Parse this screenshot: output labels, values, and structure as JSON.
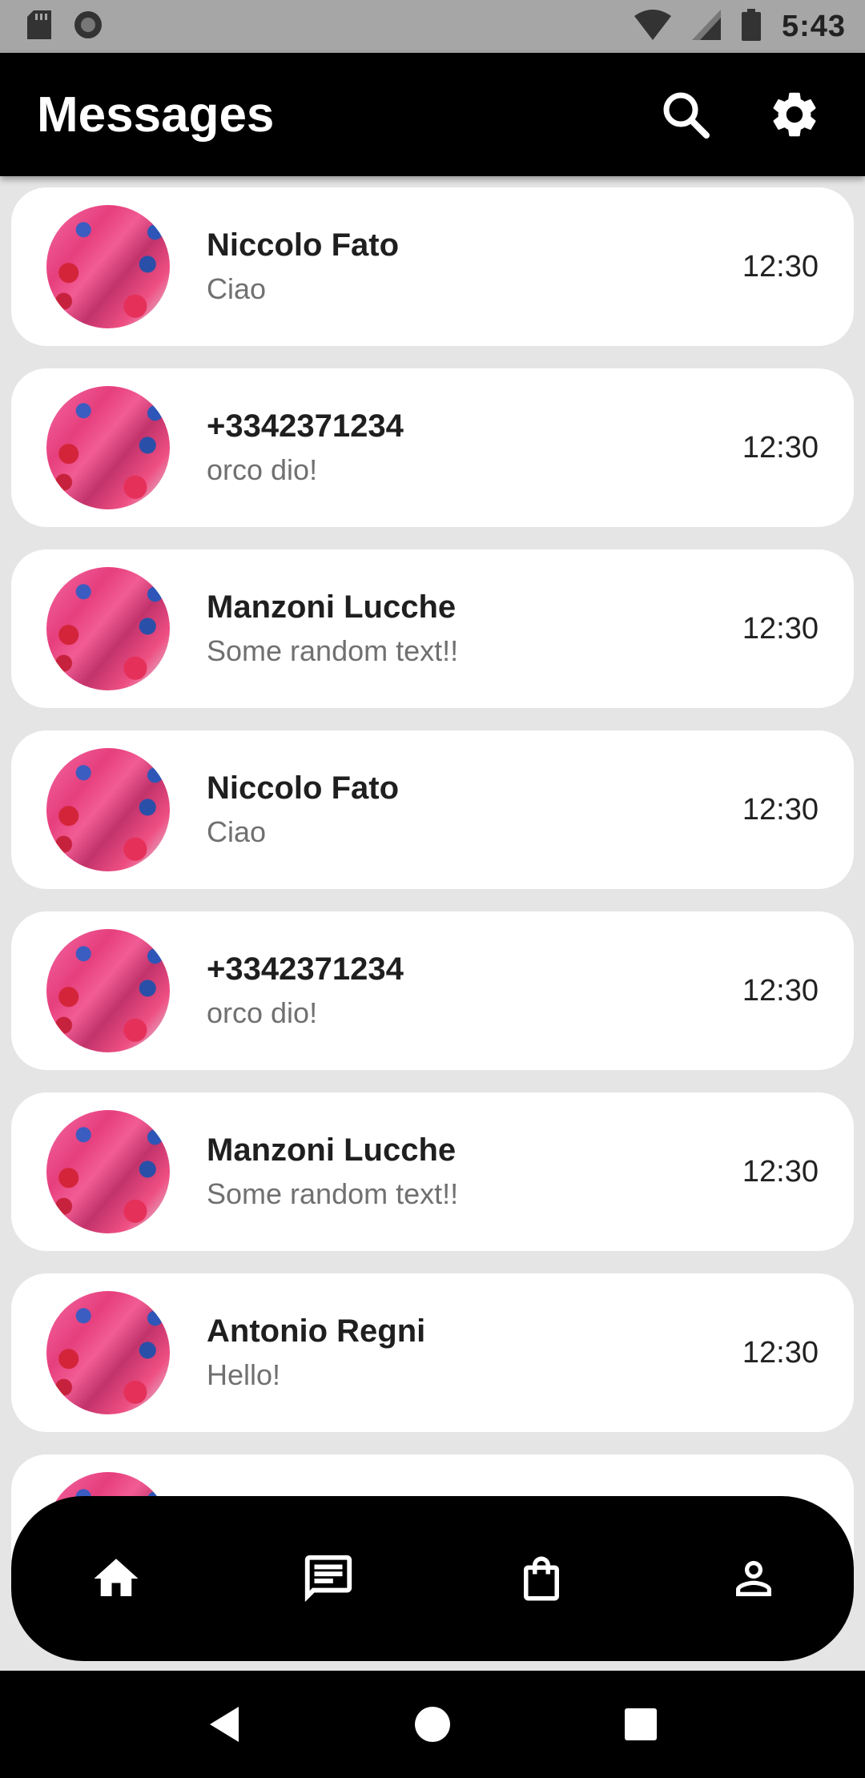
{
  "status_bar": {
    "time": "5:43",
    "icons": [
      "sd-card-icon",
      "record-icon",
      "wifi-icon",
      "cell-signal-icon",
      "battery-icon"
    ]
  },
  "app_bar": {
    "title": "Messages",
    "actions": [
      "search-icon",
      "settings-gear-icon"
    ]
  },
  "conversations": [
    {
      "name": "Niccolo Fato",
      "preview": "Ciao",
      "time": "12:30"
    },
    {
      "name": "+3342371234",
      "preview": "orco dio!",
      "time": "12:30"
    },
    {
      "name": "Manzoni Lucche",
      "preview": "Some random text!!",
      "time": "12:30"
    },
    {
      "name": "Niccolo Fato",
      "preview": "Ciao",
      "time": "12:30"
    },
    {
      "name": "+3342371234",
      "preview": "orco dio!",
      "time": "12:30"
    },
    {
      "name": "Manzoni Lucche",
      "preview": "Some random text!!",
      "time": "12:30"
    },
    {
      "name": "Antonio Regni",
      "preview": "Hello!",
      "time": "12:30"
    }
  ],
  "bottom_nav": {
    "items": [
      "home-icon",
      "chat-icon",
      "shopping-bag-icon",
      "profile-icon"
    ]
  },
  "system_nav": {
    "items": [
      "back-icon",
      "home-circle-icon",
      "recents-square-icon"
    ]
  },
  "colors": {
    "app_bar": "#000000",
    "background": "#e5e5e5",
    "card": "#ffffff",
    "status_bar": "#a6a6a6"
  }
}
